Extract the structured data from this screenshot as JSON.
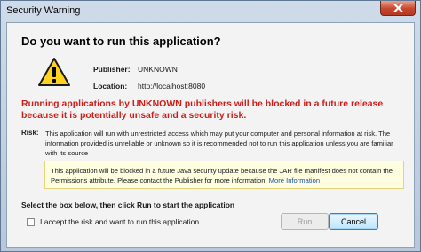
{
  "window": {
    "title": "Security Warning"
  },
  "dialog": {
    "heading": "Do you want to run this application?",
    "publisher_label": "Publisher:",
    "publisher_value": "UNKNOWN",
    "location_label": "Location:",
    "location_value": "http://localhost:8080",
    "red_warning": "Running applications by UNKNOWN publishers will be blocked in a future release because it is potentially unsafe and a security risk.",
    "risk_label": "Risk:",
    "risk_text": "This application will run with unrestricted access which may put your computer and personal information at risk. The information provided is unreliable or unknown so it is recommended not to run this application unless you are familiar with its source",
    "notice_text": "This application will be blocked in a future Java security update because the JAR file manifest does not contain the Permissions attribute. Please contact the Publisher for more information.",
    "more_info_link": "More Information",
    "select_text": "Select the box below, then click Run to start the application",
    "accept_label": "I accept the risk and want to run this application.",
    "accept_checked": false,
    "run_label": "Run",
    "cancel_label": "Cancel"
  },
  "colors": {
    "warning_red": "#cc1f1a",
    "link_blue": "#1a52a8",
    "notice_background": "#fffde0",
    "icon_yellow": "#ffd21f"
  },
  "icons": {
    "close": "close-icon",
    "warning": "warning-triangle-icon"
  }
}
